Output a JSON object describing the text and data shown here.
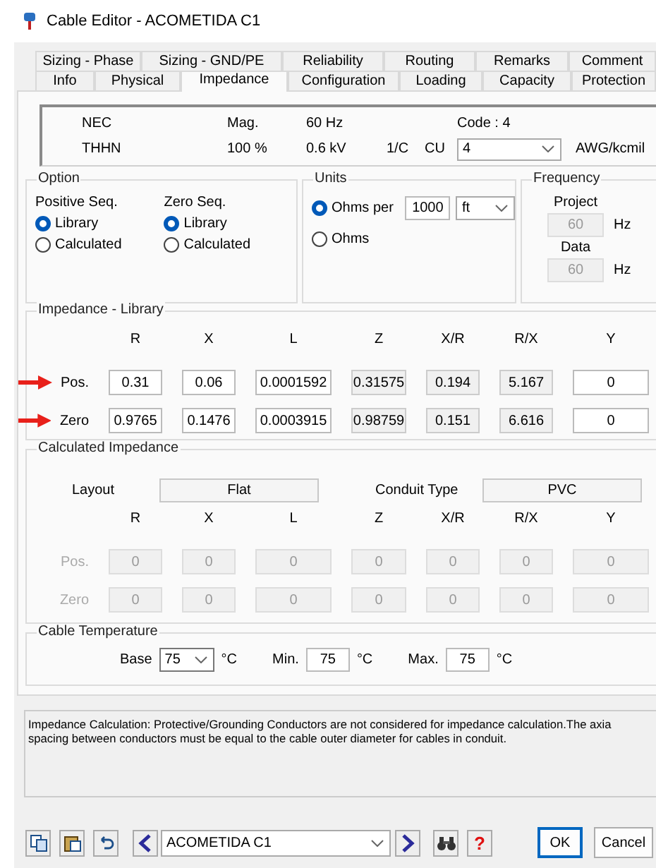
{
  "window": {
    "title": "Cable Editor - ACOMETIDA C1"
  },
  "tabs": [
    [
      {
        "label": "Sizing - Phase",
        "selected": false
      },
      {
        "label": "Sizing - GND/PE",
        "selected": false
      },
      {
        "label": "Reliability",
        "selected": false
      },
      {
        "label": "Routing",
        "selected": false
      },
      {
        "label": "Remarks",
        "selected": false
      },
      {
        "label": "Comment",
        "selected": false
      }
    ],
    [
      {
        "label": "Info",
        "selected": false
      },
      {
        "label": "Physical",
        "selected": false
      },
      {
        "label": "Impedance",
        "selected": true
      },
      {
        "label": "Configuration",
        "selected": false
      },
      {
        "label": "Loading",
        "selected": false
      },
      {
        "label": "Capacity",
        "selected": false
      },
      {
        "label": "Protection",
        "selected": false
      }
    ]
  ],
  "header": {
    "standard": "NEC",
    "insulation": "THHN",
    "mag_label": "Mag.",
    "mag": "100 %",
    "frequency": "60 Hz",
    "voltage": "0.6 kV",
    "conductors": "1/C",
    "material": "CU",
    "code": "Code : 4",
    "size": "4",
    "size_unit": "AWG/kcmil"
  },
  "option": {
    "title": "Option",
    "groups": [
      {
        "label": "Positive Seq.",
        "options": [
          {
            "label": "Library",
            "selected": true
          },
          {
            "label": "Calculated",
            "selected": false
          }
        ]
      },
      {
        "label": "Zero Seq.",
        "options": [
          {
            "label": "Library",
            "selected": true
          },
          {
            "label": "Calculated",
            "selected": false
          }
        ]
      }
    ]
  },
  "units": {
    "title": "Units",
    "options": [
      {
        "label": "Ohms per",
        "selected": true
      },
      {
        "label": "Ohms",
        "selected": false
      }
    ],
    "length": "1000",
    "length_unit": "ft"
  },
  "frequency": {
    "title": "Frequency",
    "fields": [
      {
        "label": "Project",
        "value": "60",
        "unit": "Hz",
        "disabled": true
      },
      {
        "label": "Data",
        "value": "60",
        "unit": "Hz",
        "disabled": true
      }
    ]
  },
  "impedance_library": {
    "title": "Impedance - Library",
    "columns": [
      "R",
      "X",
      "L",
      "Z",
      "X/R",
      "R/X",
      "Y"
    ],
    "rows": [
      {
        "label": "Pos.",
        "arrow": true,
        "disabled": false,
        "cells": [
          {
            "value": "0.31",
            "editable": true
          },
          {
            "value": "0.06",
            "editable": true
          },
          {
            "value": "0.0001592",
            "editable": true
          },
          {
            "value": "0.31575",
            "editable": false
          },
          {
            "value": "0.194",
            "editable": false
          },
          {
            "value": "5.167",
            "editable": false
          },
          {
            "value": "0",
            "editable": true
          }
        ]
      },
      {
        "label": "Zero",
        "arrow": true,
        "disabled": false,
        "cells": [
          {
            "value": "0.9765",
            "editable": true
          },
          {
            "value": "0.1476",
            "editable": true
          },
          {
            "value": "0.0003915",
            "editable": true
          },
          {
            "value": "0.98759",
            "editable": false
          },
          {
            "value": "0.151",
            "editable": false
          },
          {
            "value": "6.616",
            "editable": false
          },
          {
            "value": "0",
            "editable": true
          }
        ]
      }
    ]
  },
  "calculated_impedance": {
    "title": "Calculated Impedance",
    "layout_label": "Layout",
    "layout": "Flat",
    "conduit_label": "Conduit Type",
    "conduit": "PVC",
    "columns": [
      "R",
      "X",
      "L",
      "Z",
      "X/R",
      "R/X",
      "Y"
    ],
    "rows": [
      {
        "label": "Pos.",
        "arrow": false,
        "disabled": true,
        "cells": [
          {
            "value": "0"
          },
          {
            "value": "0"
          },
          {
            "value": "0"
          },
          {
            "value": "0"
          },
          {
            "value": "0"
          },
          {
            "value": "0"
          },
          {
            "value": "0"
          }
        ]
      },
      {
        "label": "Zero",
        "arrow": false,
        "disabled": true,
        "cells": [
          {
            "value": "0"
          },
          {
            "value": "0"
          },
          {
            "value": "0"
          },
          {
            "value": "0"
          },
          {
            "value": "0"
          },
          {
            "value": "0"
          },
          {
            "value": "0"
          }
        ]
      }
    ]
  },
  "cable_temperature": {
    "title": "Cable Temperature",
    "base_label": "Base",
    "base": "75",
    "base_unit": "°C",
    "min_label": "Min.",
    "min": "75",
    "min_unit": "°C",
    "max_label": "Max.",
    "max": "75",
    "max_unit": "°C"
  },
  "note": [
    "Impedance Calculation: Protective/Grounding Conductors are not considered for impedance calculation.The axia",
    "spacing between conductors must be equal to the cable outer diameter for cables in conduit."
  ],
  "footer": {
    "record": "ACOMETIDA C1",
    "help": "?",
    "buttons": [
      "OK",
      "Cancel"
    ]
  }
}
